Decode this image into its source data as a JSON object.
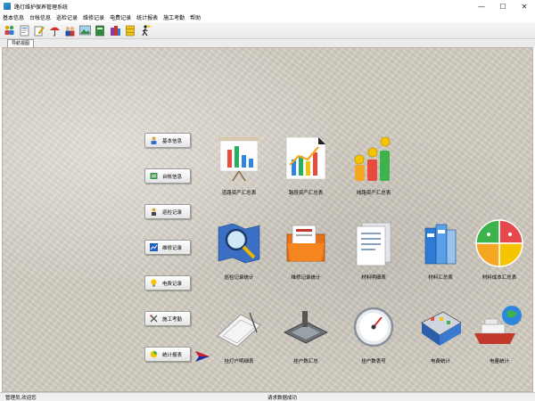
{
  "window": {
    "title": "路灯维护保养管理系统",
    "minimize_glyph": "—",
    "maximize_glyph": "☐",
    "close_glyph": "✕"
  },
  "menu": [
    {
      "label": "基本信息"
    },
    {
      "label": "台帐信息"
    },
    {
      "label": "巡检记录"
    },
    {
      "label": "维修记录"
    },
    {
      "label": "电费记录"
    },
    {
      "label": "统计报表"
    },
    {
      "label": "施工考勤"
    },
    {
      "label": "帮助"
    }
  ],
  "toolbar": {
    "icons": [
      "group-icon",
      "document-icon",
      "edit-icon",
      "umbrella-icon",
      "people-icon",
      "landscape-icon",
      "book-icon",
      "books-icon",
      "drawers-icon",
      "walking-person-icon"
    ]
  },
  "tab": {
    "label": "导航视图"
  },
  "side_buttons": [
    {
      "label": "基本信息",
      "icon": "person-icon"
    },
    {
      "label": "台帐信息",
      "icon": "ledger-icon"
    },
    {
      "label": "巡检记录",
      "icon": "inspector-icon"
    },
    {
      "label": "维修记录",
      "icon": "chart-line-icon"
    },
    {
      "label": "电费记录",
      "icon": "bulb-icon"
    },
    {
      "label": "施工考勤",
      "icon": "tools-icon"
    },
    {
      "label": "统计报表",
      "icon": "report-icon"
    }
  ],
  "tiles": [
    {
      "label": "道路资产汇总表"
    },
    {
      "label": "路段资产汇总表"
    },
    {
      "label": "线路资产汇总表"
    },
    {
      "label": "巡检记录统计"
    },
    {
      "label": "维修记录统计"
    },
    {
      "label": "材料明细表"
    },
    {
      "label": "材料汇总表"
    },
    {
      "label": "材料成本汇总表"
    },
    {
      "label": "挂灯户明细表"
    },
    {
      "label": "挂户数汇总"
    },
    {
      "label": "挂户数表号"
    },
    {
      "label": "电费统计"
    },
    {
      "label": "电量统计"
    }
  ],
  "status": {
    "left": "管理员,欢迎您",
    "center": "请求数据成功"
  },
  "colors": {
    "background": "#d4cfc4",
    "accent_green": "#3cb44b",
    "accent_orange": "#f5a623",
    "accent_red": "#e03b3b"
  }
}
